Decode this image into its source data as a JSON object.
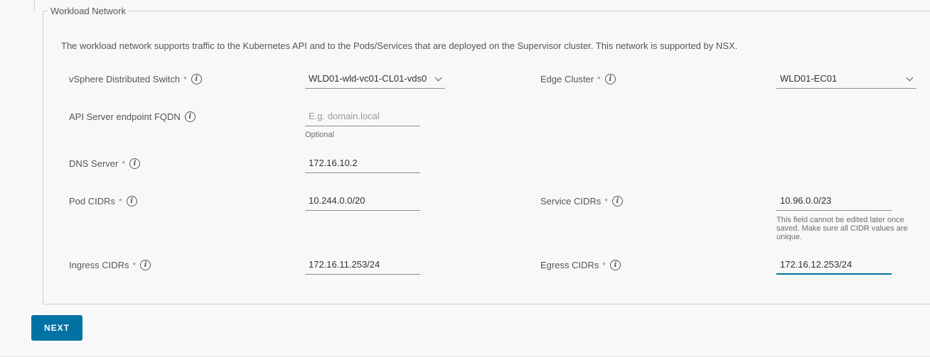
{
  "section": {
    "legend": "Workload Network",
    "description": "The workload network supports traffic to the Kubernetes API and to the Pods/Services that are deployed on the Supervisor cluster. This network is supported by NSX."
  },
  "fields": {
    "vds": {
      "label": "vSphere Distributed Switch",
      "required": "*",
      "value": "WLD01-wld-vc01-CL01-vds0"
    },
    "edge": {
      "label": "Edge Cluster",
      "required": "*",
      "value": "WLD01-EC01"
    },
    "fqdn": {
      "label": "API Server endpoint FQDN",
      "placeholder": "E.g. domain.local",
      "hint": "Optional"
    },
    "dns": {
      "label": "DNS Server",
      "required": "*",
      "value": "172.16.10.2"
    },
    "pod": {
      "label": "Pod CIDRs",
      "required": "*",
      "value": "10.244.0.0/20"
    },
    "service": {
      "label": "Service CIDRs",
      "required": "*",
      "value": "10.96.0.0/23",
      "hint": "This field cannot be edited later once saved. Make sure all CIDR values are unique."
    },
    "ingress": {
      "label": "Ingress CIDRs",
      "required": "*",
      "value": "172.16.11.253/24"
    },
    "egress": {
      "label": "Egress CIDRs",
      "required": "*",
      "value": "172.16.12.253/24"
    }
  },
  "info_glyph": "i",
  "actions": {
    "next_label": "NEXT"
  },
  "colors": {
    "primary": "#0072a3",
    "background": "#f8f8f8",
    "text": "#565656"
  }
}
